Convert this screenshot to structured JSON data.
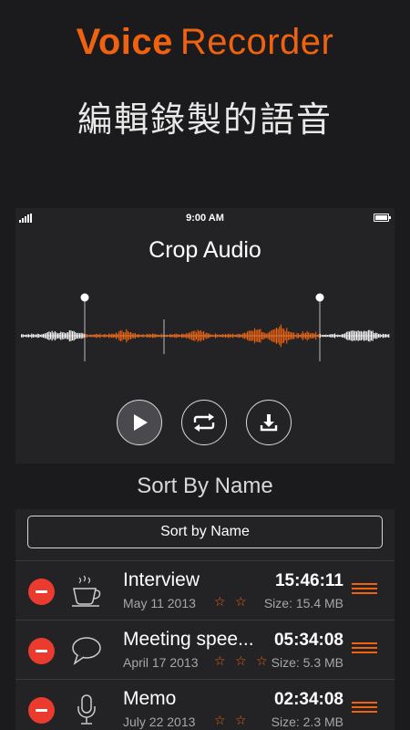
{
  "promo": {
    "title_word1": "Voice",
    "title_word2": "Recorder",
    "subtitle": "編輯錄製的語音",
    "accent_color": "#f0620f"
  },
  "status_bar": {
    "time": "9:00 AM",
    "icons": [
      "signal-icon",
      "battery-icon"
    ]
  },
  "screen": {
    "title": "Crop Audio",
    "controls": [
      "play-icon",
      "repeat-icon",
      "download-icon"
    ]
  },
  "sort": {
    "header": "Sort By Name",
    "button_label": "Sort by Name"
  },
  "recordings": [
    {
      "name": "Interview",
      "date": "May 11 2013",
      "stars": "☆ ☆",
      "time": "15:46:11",
      "size": "Size: 15.4 MB",
      "icon": "coffee-cup-icon"
    },
    {
      "name": "Meeting spee...",
      "date": "April 17 2013",
      "stars": "☆ ☆ ☆",
      "time": "05:34:08",
      "size": "Size: 5.3 MB",
      "icon": "speech-bubble-icon"
    },
    {
      "name": "Memo",
      "date": "July 22 2013",
      "stars": "☆ ☆",
      "time": "02:34:08",
      "size": "Size: 2.3 MB",
      "icon": "microphone-icon"
    }
  ]
}
